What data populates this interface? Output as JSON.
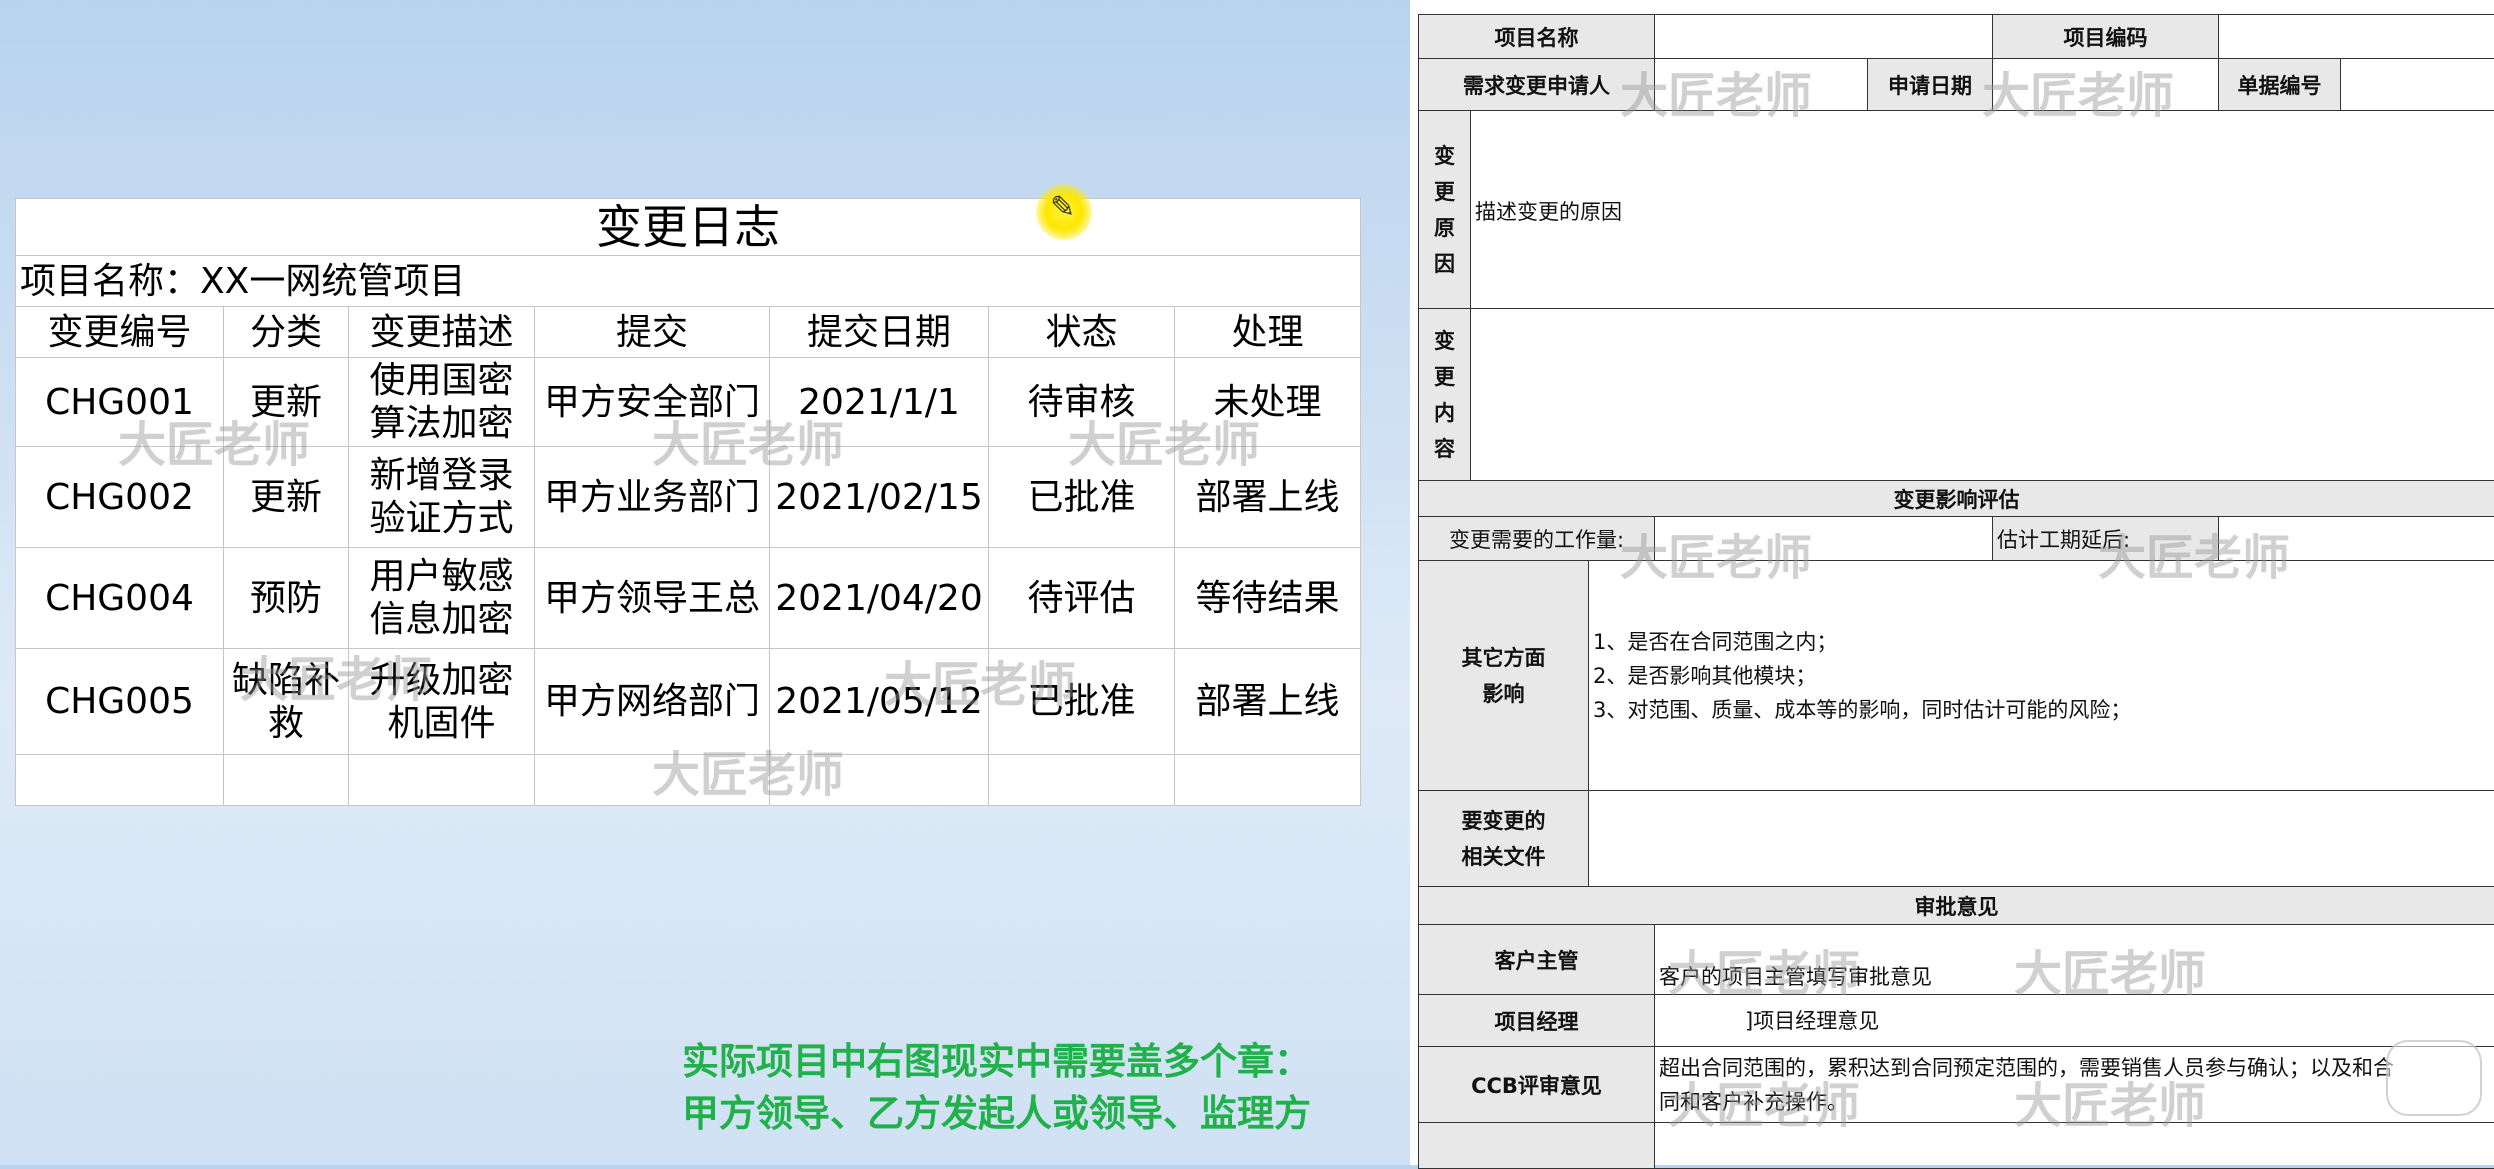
{
  "change_log": {
    "title": "变更日志",
    "project_line": "项目名称：XX一网统管项目",
    "headers": [
      "变更编号",
      "分类",
      "变更描述",
      "提交",
      "提交日期",
      "状态",
      "处理"
    ],
    "rows": [
      {
        "id": "CHG001",
        "category": "更新",
        "desc": "使用国密算法加密",
        "submitter": "甲方安全部门",
        "date": "2021/1/1",
        "status": "待审核",
        "handling": "未处理"
      },
      {
        "id": "CHG002",
        "category": "更新",
        "desc": "新增登录验证方式",
        "submitter": "甲方业务部门",
        "date": "2021/02/15",
        "status": "已批准",
        "handling": "部署上线"
      },
      {
        "id": "CHG004",
        "category": "预防",
        "desc": "用户敏感信息加密",
        "submitter": "甲方领导王总",
        "date": "2021/04/20",
        "status": "待评估",
        "handling": "等待结果"
      },
      {
        "id": "CHG005",
        "category": "缺陷补救",
        "desc": "升级加密机固件",
        "submitter": "甲方网络部门",
        "date": "2021/05/12",
        "status": "已批准",
        "handling": "部署上线"
      }
    ]
  },
  "watermark": "大匠老师",
  "note": {
    "line1": "实际项目中右图现实中需要盖多个章：",
    "line2": "甲方领导、乙方发起人或领导、监理方"
  },
  "form": {
    "project_name_label": "项目名称",
    "project_code_label": "项目编码",
    "requester_label": "需求变更申请人",
    "apply_date_label": "申请日期",
    "doc_no_label": "单据编号",
    "reason_label": "变更原因",
    "reason_text": "描述变更的原因",
    "content_label": "变更内容",
    "impact_section": "变更影响评估",
    "workload_label": "变更需要的工作量:",
    "delay_label": "估计工期延后:",
    "other_impact_label": "其它方面影响",
    "other_impact_lines": [
      "1、是否在合同范围之内；",
      "2、是否影响其他模块；",
      "3、对范围、质量、成本等的影响，同时估计可能的风险；"
    ],
    "related_docs_label": "要变更的相关文件",
    "approval_section": "审批意见",
    "customer_lead_label": "客户主管",
    "customer_lead_text": "客户的项目主管填写审批意见",
    "pm_label": "项目经理",
    "pm_text": "]项目经理意见",
    "ccb_label": "CCB评审意见",
    "ccb_text_1": "超出合同范围的，累积达到合同预定范围的，需要销售人员参与确认；以及和合",
    "ccb_text_2": "同和客户补充操作。"
  },
  "colors": {
    "note_green": "#20b14a",
    "highlight_yellow": "#ffe600"
  }
}
